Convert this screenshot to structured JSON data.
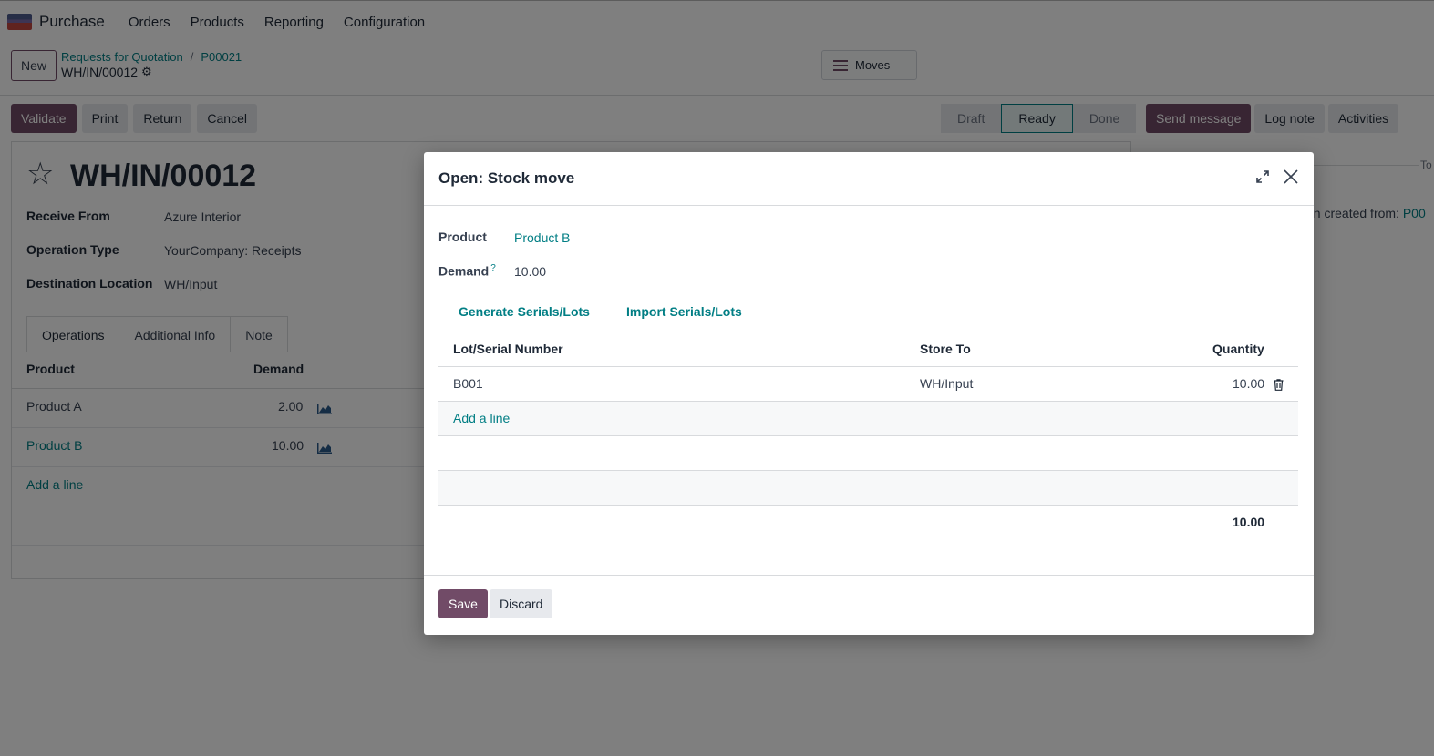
{
  "navbar": {
    "app_name": "Purchase",
    "menu": [
      "Orders",
      "Products",
      "Reporting",
      "Configuration"
    ]
  },
  "control": {
    "new_label": "New",
    "breadcrumb": [
      "Requests for Quotation",
      "P00021"
    ],
    "record_name": "WH/IN/00012",
    "moves_label": "Moves"
  },
  "actions": {
    "validate": "Validate",
    "print": "Print",
    "return": "Return",
    "cancel": "Cancel"
  },
  "status": {
    "stages": [
      "Draft",
      "Ready",
      "Done"
    ],
    "active": "Ready"
  },
  "chatter": {
    "send_message": "Send message",
    "log_note": "Log note",
    "activities": "Activities",
    "tag": "To",
    "message_prefix": "en created from:",
    "message_link": "P00"
  },
  "form": {
    "title": "WH/IN/00012",
    "fields": [
      {
        "label": "Receive From",
        "value": "Azure Interior"
      },
      {
        "label": "Operation Type",
        "value": "YourCompany: Receipts"
      },
      {
        "label": "Destination Location",
        "value": "WH/Input"
      }
    ],
    "tabs": [
      "Operations",
      "Additional Info",
      "Note"
    ],
    "ops_headers": {
      "product": "Product",
      "demand": "Demand"
    },
    "ops_rows": [
      {
        "product": "Product A",
        "demand": "2.00"
      },
      {
        "product": "Product B",
        "demand": "10.00"
      }
    ],
    "add_line": "Add a line"
  },
  "dialog": {
    "title": "Open: Stock move",
    "product_label": "Product",
    "product_value": "Product B",
    "demand_label": "Demand",
    "demand_help": "?",
    "demand_value": "10.00",
    "generate_label": "Generate Serials/Lots",
    "import_label": "Import Serials/Lots",
    "headers": {
      "lot": "Lot/Serial Number",
      "store": "Store To",
      "qty": "Quantity"
    },
    "lines": [
      {
        "lot": "B001",
        "store": "WH/Input",
        "qty": "10.00"
      }
    ],
    "add_line": "Add a line",
    "total": "10.00",
    "save": "Save",
    "discard": "Discard"
  },
  "colors": {
    "primary": "#714b67",
    "link": "#017e84"
  }
}
